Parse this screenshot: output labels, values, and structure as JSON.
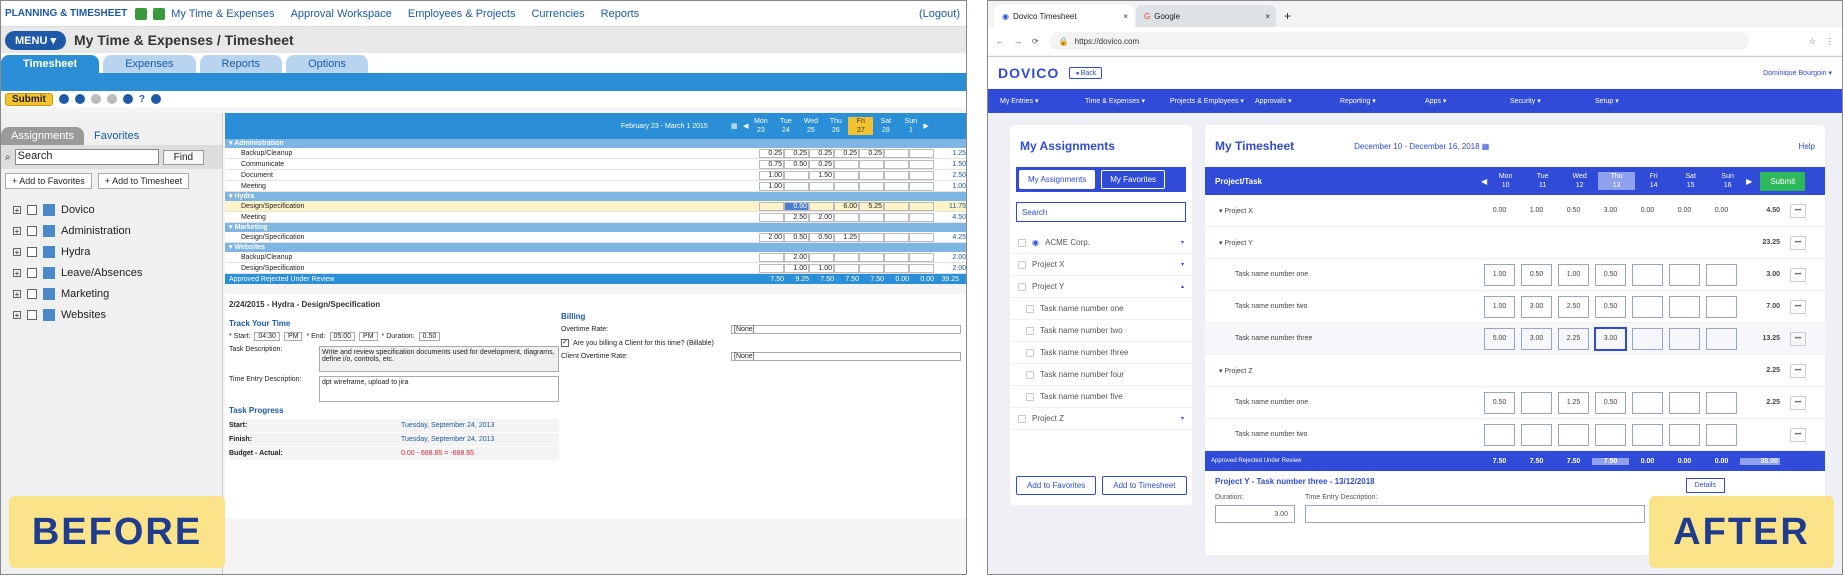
{
  "before": {
    "logo": "PLANNING & TIMESHEET",
    "topnav": [
      "My Time & Expenses",
      "Approval Workspace",
      "Employees & Projects",
      "Currencies",
      "Reports"
    ],
    "logout": "(Logout)",
    "menu": "MENU",
    "title": "My Time & Expenses / Timesheet",
    "tabs": [
      "Timesheet",
      "Expenses",
      "Reports",
      "Options"
    ],
    "submit": "Submit",
    "left_tabs": [
      "Assignments",
      "Favorites"
    ],
    "search_value": "Search",
    "find": "Find",
    "add_fav": "Add to Favorites",
    "add_ts": "Add to Timesheet",
    "tree": [
      "Dovico",
      "Administration",
      "Hydra",
      "Leave/Absences",
      "Marketing",
      "Websites"
    ],
    "range": "February 23 - March 1 2015",
    "days": [
      {
        "d": "Mon",
        "n": "23"
      },
      {
        "d": "Tue",
        "n": "24"
      },
      {
        "d": "Wed",
        "n": "25"
      },
      {
        "d": "Thu",
        "n": "26"
      },
      {
        "d": "Fri",
        "n": "27"
      },
      {
        "d": "Sat",
        "n": "28"
      },
      {
        "d": "Sun",
        "n": "1"
      }
    ],
    "groups": [
      {
        "name": "Administration",
        "rows": [
          {
            "task": "Backup/Cleanup",
            "v": [
              "0.25",
              "0.25",
              "0.25",
              "0.25",
              "0.25",
              "",
              ""
            ],
            "t": "1.25"
          },
          {
            "task": "Communicate",
            "v": [
              "0.75",
              "0.50",
              "0.25",
              "",
              "",
              "",
              ""
            ],
            "t": "1.50"
          },
          {
            "task": "Document",
            "v": [
              "1.00",
              "",
              "1.50",
              "",
              "",
              "",
              ""
            ],
            "t": "2.50"
          },
          {
            "task": "Meeting",
            "v": [
              "1.00",
              "",
              "",
              "",
              "",
              "",
              ""
            ],
            "t": "1.00"
          }
        ]
      },
      {
        "name": "Hydra",
        "rows": [
          {
            "task": "Design/Specification",
            "v": [
              "",
              "0.50",
              "",
              "6.00",
              "5.25",
              "",
              ""
            ],
            "t": "11.75"
          },
          {
            "task": "Meeting",
            "v": [
              "",
              "2.50",
              "2.00",
              "",
              "",
              "",
              ""
            ],
            "t": "4.50"
          }
        ]
      },
      {
        "name": "Marketing",
        "rows": [
          {
            "task": "Design/Specification",
            "v": [
              "2.00",
              "0.50",
              "0.50",
              "1.25",
              "",
              "",
              ""
            ],
            "t": "4.25"
          }
        ]
      },
      {
        "name": "Websites",
        "rows": [
          {
            "task": "Backup/Cleanup",
            "v": [
              "",
              "2.00",
              "",
              "",
              "",
              "",
              ""
            ],
            "t": "2.00"
          },
          {
            "task": "Design/Specification",
            "v": [
              "",
              "1.00",
              "1.00",
              "",
              "",
              "",
              ""
            ],
            "t": "2.00"
          }
        ]
      }
    ],
    "legend": "Approved   Rejected   Under Review",
    "totals": [
      "7.50",
      "9.25",
      "7.50",
      "7.50",
      "7.50",
      "0.00",
      "0.00",
      "39.25"
    ],
    "detail_title": "2/24/2015 - Hydra - Design/Specification",
    "track": "Track Your Time",
    "start_label": "* Start:",
    "start_value": "04:30",
    "start_ampm": "PM",
    "end_label": "* End:",
    "end_value": "05:00",
    "end_ampm": "PM",
    "duration_label": "* Duration:",
    "duration": "0.50",
    "task_desc_label": "Task Description:",
    "task_desc": "Write and review specification documents used for development, diagrams, define i/o, controls, etc.",
    "entry_desc_label": "Time Entry Description:",
    "entry_desc": "dpt wireframe, upload to jira",
    "billing": "Billing",
    "overtime_label": "Overtime Rate:",
    "overtime": "[None]",
    "billable": "Are you billing a Client for this time? (Billable)",
    "client_ot_label": "Client Overtime Rate:",
    "client_ot": "[None]",
    "progress": "Task Progress",
    "start_row": {
      "k": "Start:",
      "v": "Tuesday, September 24, 2013"
    },
    "finish_row": {
      "k": "Finish:",
      "v": "Tuesday, September 24, 2013"
    },
    "budget_row": {
      "k": "Budget - Actual:",
      "v": "0.00 - 668.65 = -668.65"
    }
  },
  "after": {
    "tab1": "Dovico Timesheet",
    "tab2": "Google",
    "url": "https://dovico.com",
    "logo": "DOVICO",
    "back": "Back",
    "user": "Dominique Bourgoin",
    "nav": [
      "My Entries",
      "Time & Expenses",
      "Projects & Employees",
      "Approvals",
      "Reporting",
      "Apps",
      "Security",
      "Setup"
    ],
    "assign_title": "My Assignments",
    "ltabs": [
      "My Assignments",
      "My Favorites"
    ],
    "search": "Search",
    "litems": [
      "ACME Corp.",
      "Project X",
      "Project Y"
    ],
    "subitems": [
      "Task name number one",
      "Task name number two",
      "Task name number three",
      "Task name number four",
      "Task name number five"
    ],
    "litem_last": "Project Z",
    "add_fav": "Add to Favorites",
    "add_ts": "Add to Timesheet",
    "ts_title": "My Timesheet",
    "range": "December 10 - December 16, 2018",
    "help": "Help",
    "col": "Project/Task",
    "days": [
      {
        "d": "Mon",
        "n": "10"
      },
      {
        "d": "Tue",
        "n": "11"
      },
      {
        "d": "Wed",
        "n": "12"
      },
      {
        "d": "Thu",
        "n": "13"
      },
      {
        "d": "Fri",
        "n": "14"
      },
      {
        "d": "Sat",
        "n": "15"
      },
      {
        "d": "Sun",
        "n": "16"
      }
    ],
    "submit": "Submit",
    "rows": [
      {
        "name": "Project X",
        "v": [
          "0.00",
          "1.00",
          "0.50",
          "3.00",
          "0.00",
          "0.00",
          "0.00"
        ],
        "t": "4.50"
      },
      {
        "name": "Project Y",
        "t": "23.25"
      },
      {
        "name": "Task name number one",
        "v": [
          "1.00",
          "0.50",
          "1.00",
          "0.50",
          "",
          "",
          ""
        ],
        "t": "3.00"
      },
      {
        "name": "Task name number two",
        "v": [
          "1.00",
          "3.00",
          "2.50",
          "0.50",
          "",
          "",
          ""
        ],
        "t": "7.00"
      },
      {
        "name": "Task name number three",
        "v": [
          "5.00",
          "3.00",
          "2.25",
          "3.00",
          "",
          "",
          ""
        ],
        "t": "13.25"
      },
      {
        "name": "Project Z",
        "t": "2.25"
      },
      {
        "name": "Task name number one",
        "v": [
          "0.50",
          "",
          "1.25",
          "0.50",
          "",
          "",
          ""
        ],
        "t": "2.25"
      },
      {
        "name": "Task name number two",
        "v": [
          "",
          "",
          "",
          "",
          "",
          "",
          ""
        ],
        "t": ""
      }
    ],
    "legend": "Approved  Rejected  Under Review",
    "totals": [
      "7.50",
      "7.50",
      "7.50",
      "7.50",
      "0.00",
      "0.00",
      "0.00"
    ],
    "grand": "30.00",
    "detail_title": "Project Y - Task number three - 13/12/2018",
    "details_btn": "Details",
    "duration_label": "Duration:",
    "duration": "3.00",
    "entry_label": "Time Entry Description:"
  },
  "labels": {
    "before": "BEFORE",
    "after": "AFTER"
  }
}
